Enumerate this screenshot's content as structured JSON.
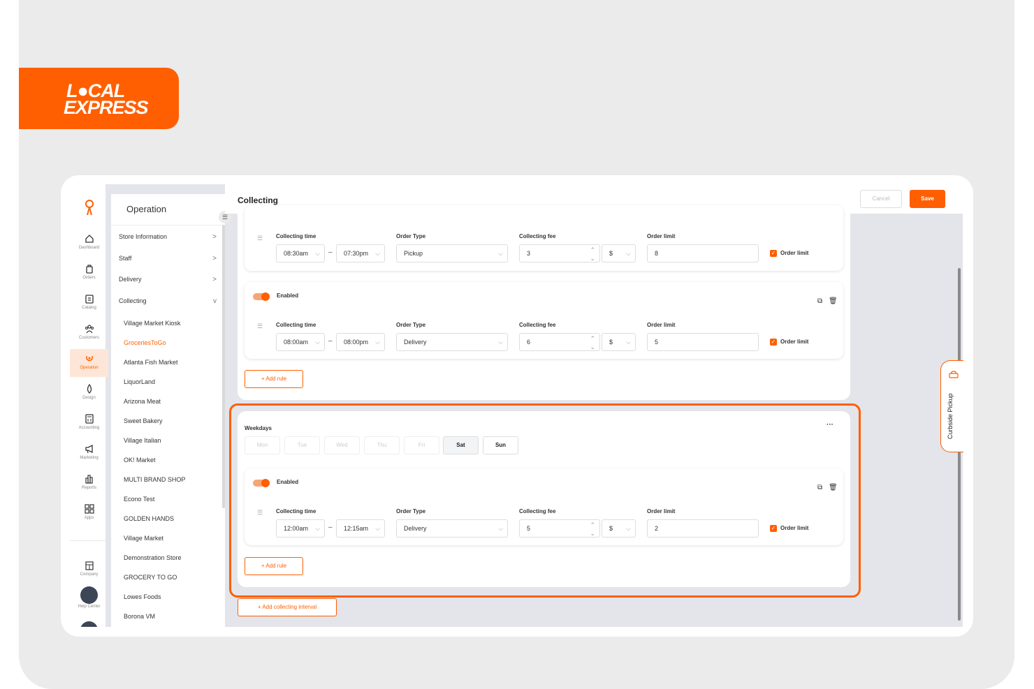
{
  "brand": {
    "line1": "L●CAL",
    "line2": "EXPRESS"
  },
  "iconbar": {
    "items": [
      {
        "label": "Dashboard",
        "icon": "home-icon"
      },
      {
        "label": "Orders",
        "icon": "bag-icon"
      },
      {
        "label": "Catalog",
        "icon": "clipboard-icon"
      },
      {
        "label": "Customers",
        "icon": "users-icon"
      },
      {
        "label": "Operation",
        "icon": "operation-icon",
        "active": true
      },
      {
        "label": "Design",
        "icon": "drop-icon"
      },
      {
        "label": "Accounting",
        "icon": "calculator-icon"
      },
      {
        "label": "Marketing",
        "icon": "megaphone-icon"
      },
      {
        "label": "Reports",
        "icon": "bar-chart-icon"
      },
      {
        "label": "Apps",
        "icon": "apps-icon"
      }
    ],
    "company": "Company",
    "help": "Help Center"
  },
  "subnav": {
    "title": "Operation",
    "items": [
      {
        "label": "Store Information",
        "chevron": ">"
      },
      {
        "label": "Staff",
        "chevron": ">"
      },
      {
        "label": "Delivery",
        "chevron": ">"
      },
      {
        "label": "Collecting",
        "chevron": "v"
      }
    ],
    "stores": [
      "Village Market Kiosk",
      "GroceriesToGo",
      "Atlanta Fish Market",
      "LiquorLand",
      "Arizona Meat",
      "Sweet Bakery",
      "Village Italian",
      "OK! Market",
      "MULTI BRAND SHOP",
      "Econo Test",
      "GOLDEN HANDS",
      "Village Market",
      "Demonstration Store",
      "GROCERY TO GO",
      "Lowes Foods",
      "Borona VM"
    ],
    "active_store": "GroceriesToGo"
  },
  "header": {
    "title": "Collecting",
    "cancel": "Cancel",
    "save": "Save"
  },
  "labels": {
    "collecting_time": "Collecting time",
    "order_type": "Order Type",
    "collecting_fee": "Collecting fee",
    "order_limit": "Order limit",
    "enabled": "Enabled",
    "order_limit_check": "Order limit",
    "currency": "$",
    "add_rule": "+ Add rule",
    "add_interval": "+ Add collecting interval",
    "dash": "–"
  },
  "rules_top": [
    {
      "from": "08:30am",
      "to": "07:30pm",
      "order_type": "Pickup",
      "fee": "3",
      "limit": "8"
    },
    {
      "from": "08:00am",
      "to": "08:00pm",
      "order_type": "Delivery",
      "fee": "6",
      "limit": "5"
    }
  ],
  "weekdays_card": {
    "title": "Weekdays",
    "more": "···",
    "days": [
      {
        "label": "Mon",
        "selected": false
      },
      {
        "label": "Tue",
        "selected": false
      },
      {
        "label": "Wed",
        "selected": false
      },
      {
        "label": "Thu",
        "selected": false
      },
      {
        "label": "Fri",
        "selected": false
      },
      {
        "label": "Sat",
        "selected": true
      },
      {
        "label": "Sun",
        "selected": true
      }
    ],
    "rule": {
      "from": "12:00am",
      "to": "12:15am",
      "order_type": "Delivery",
      "fee": "5",
      "limit": "2"
    }
  },
  "curbside": {
    "label": "Curbside Pickup"
  },
  "colors": {
    "accent": "#ff5f00",
    "background": "#e3e5ea"
  }
}
